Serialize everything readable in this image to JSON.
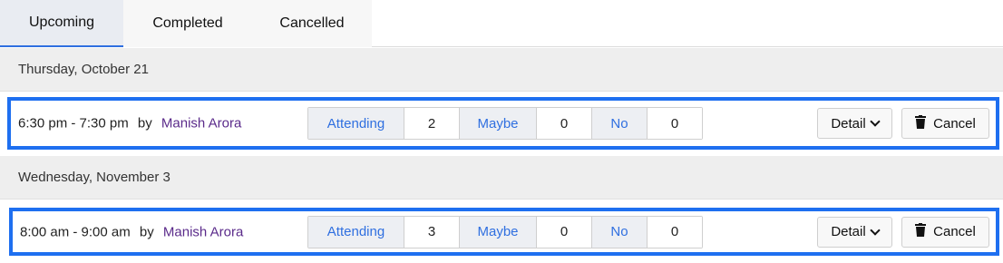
{
  "tabs": [
    {
      "label": "Upcoming",
      "active": true
    },
    {
      "label": "Completed",
      "active": false
    },
    {
      "label": "Cancelled",
      "active": false
    }
  ],
  "events": [
    {
      "date": "Thursday, October 21",
      "time": "6:30 pm - 7:30 pm",
      "by": "by",
      "host": "Manish Arora",
      "rsvp": {
        "attending_label": "Attending",
        "attending": "2",
        "maybe_label": "Maybe",
        "maybe": "0",
        "no_label": "No",
        "no": "0"
      },
      "detail_label": "Detail",
      "cancel_label": "Cancel"
    },
    {
      "date": "Wednesday, November 3",
      "time": "8:00 am - 9:00 am",
      "by": "by",
      "host": "Manish Arora",
      "rsvp": {
        "attending_label": "Attending",
        "attending": "3",
        "maybe_label": "Maybe",
        "maybe": "0",
        "no_label": "No",
        "no": "0"
      },
      "detail_label": "Detail",
      "cancel_label": "Cancel"
    }
  ],
  "colors": {
    "accent": "#2f6fe0",
    "highlight_border": "#1e6ff0",
    "host": "#5a2a8a"
  },
  "icons": {
    "detail": "chevron-down-icon",
    "cancel": "trash-icon"
  }
}
